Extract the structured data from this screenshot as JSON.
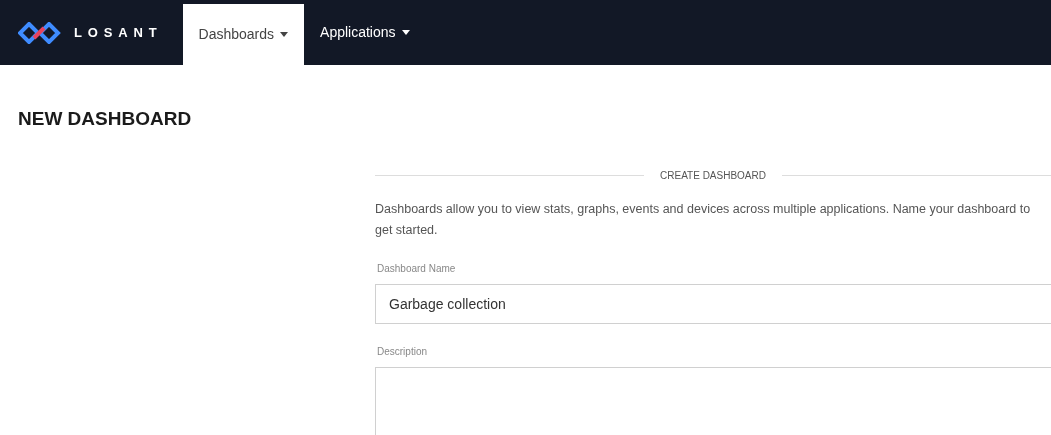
{
  "navbar": {
    "brand": "LOSANT",
    "menus": [
      {
        "label": "Dashboards",
        "selected": true
      },
      {
        "label": "Applications",
        "selected": false
      }
    ]
  },
  "page_title": "NEW DASHBOARD",
  "form": {
    "section_title": "CREATE DASHBOARD",
    "intro": "Dashboards allow you to view stats, graphs, events and devices across multiple applications. Name your dashboard to get started.",
    "fields": [
      {
        "kind": "input",
        "label": "Dashboard Name",
        "value": "Garbage collection"
      },
      {
        "kind": "textarea",
        "label": "Description"
      }
    ]
  }
}
